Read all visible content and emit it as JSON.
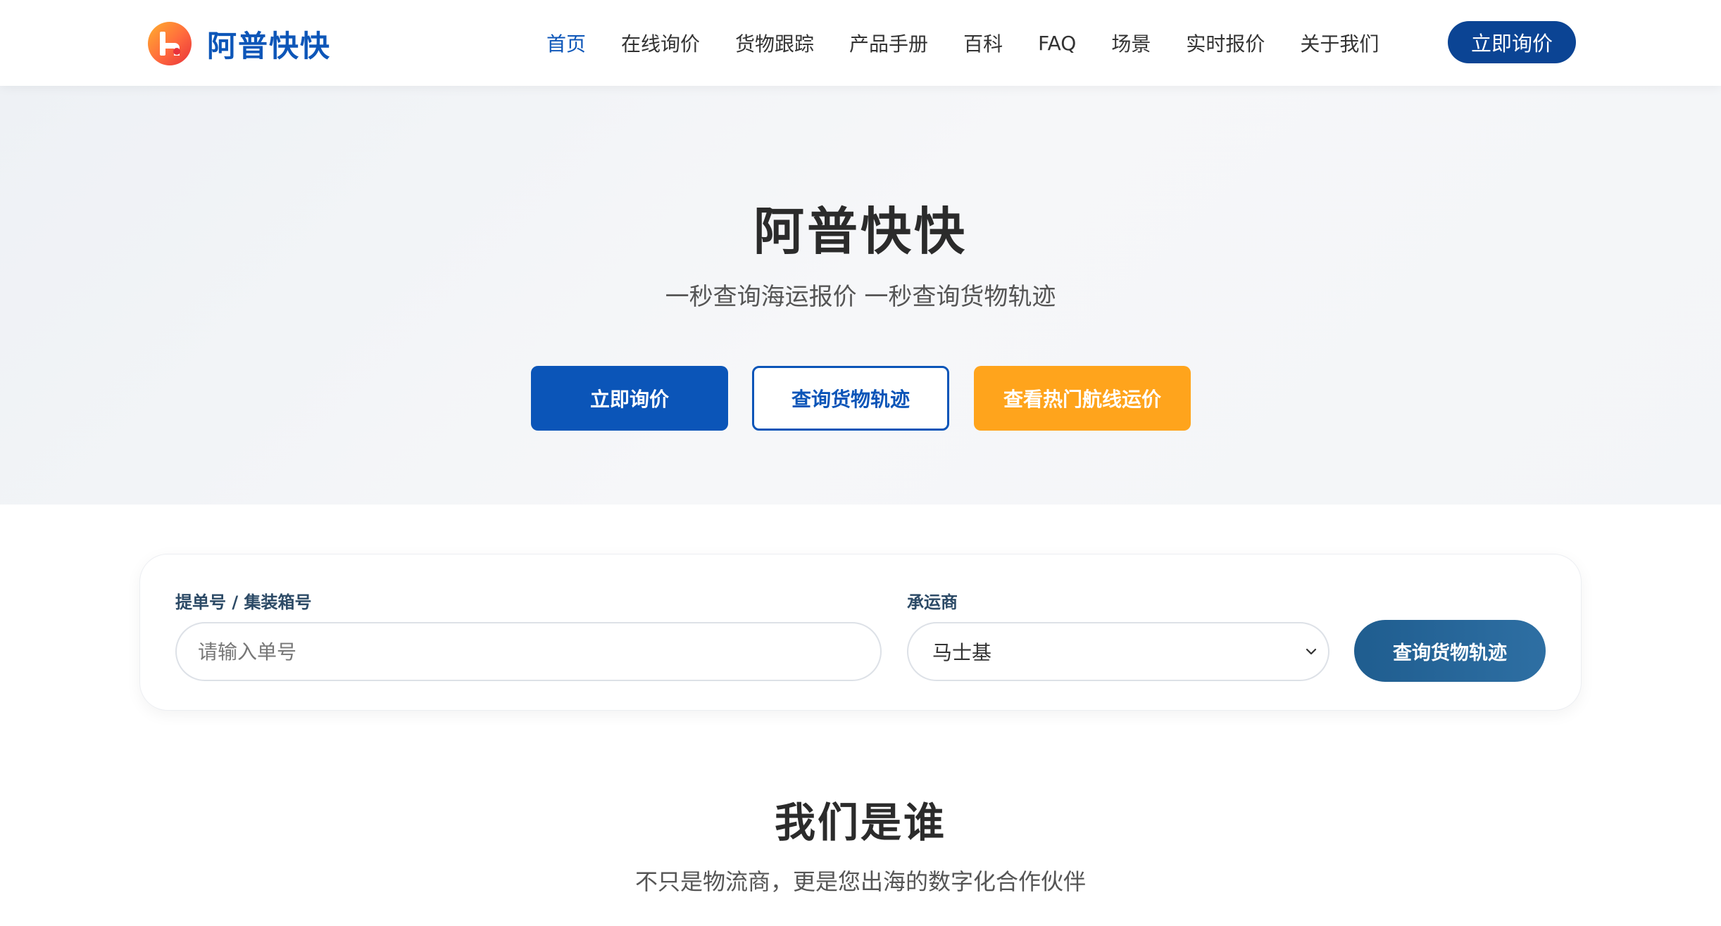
{
  "brand": {
    "name": "阿普快快",
    "logo_icon": "brand-logo-icon",
    "primary_color": "#0d56b8"
  },
  "nav": {
    "items": [
      {
        "label": "首页",
        "active": true
      },
      {
        "label": "在线询价",
        "active": false
      },
      {
        "label": "货物跟踪",
        "active": false
      },
      {
        "label": "产品手册",
        "active": false
      },
      {
        "label": "百科",
        "active": false
      },
      {
        "label": "FAQ",
        "active": false
      },
      {
        "label": "场景",
        "active": false
      },
      {
        "label": "实时报价",
        "active": false
      },
      {
        "label": "关于我们",
        "active": false
      }
    ],
    "cta_label": "立即询价"
  },
  "hero": {
    "title": "阿普快快",
    "subtitle": "一秒查询海运报价 一秒查询货物轨迹",
    "buttons": {
      "primary": "立即询价",
      "outline": "查询货物轨迹",
      "orange": "查看热门航线运价"
    },
    "orange_color": "#ffa41c"
  },
  "tracking": {
    "bill_label": "提单号 / 集装箱号",
    "bill_placeholder": "请输入单号",
    "bill_value": "",
    "carrier_label": "承运商",
    "carrier_selected": "马士基",
    "submit_label": "查询货物轨迹"
  },
  "about": {
    "title": "我们是谁",
    "subtitle": "不只是物流商，更是您出海的数字化合作伙伴"
  }
}
